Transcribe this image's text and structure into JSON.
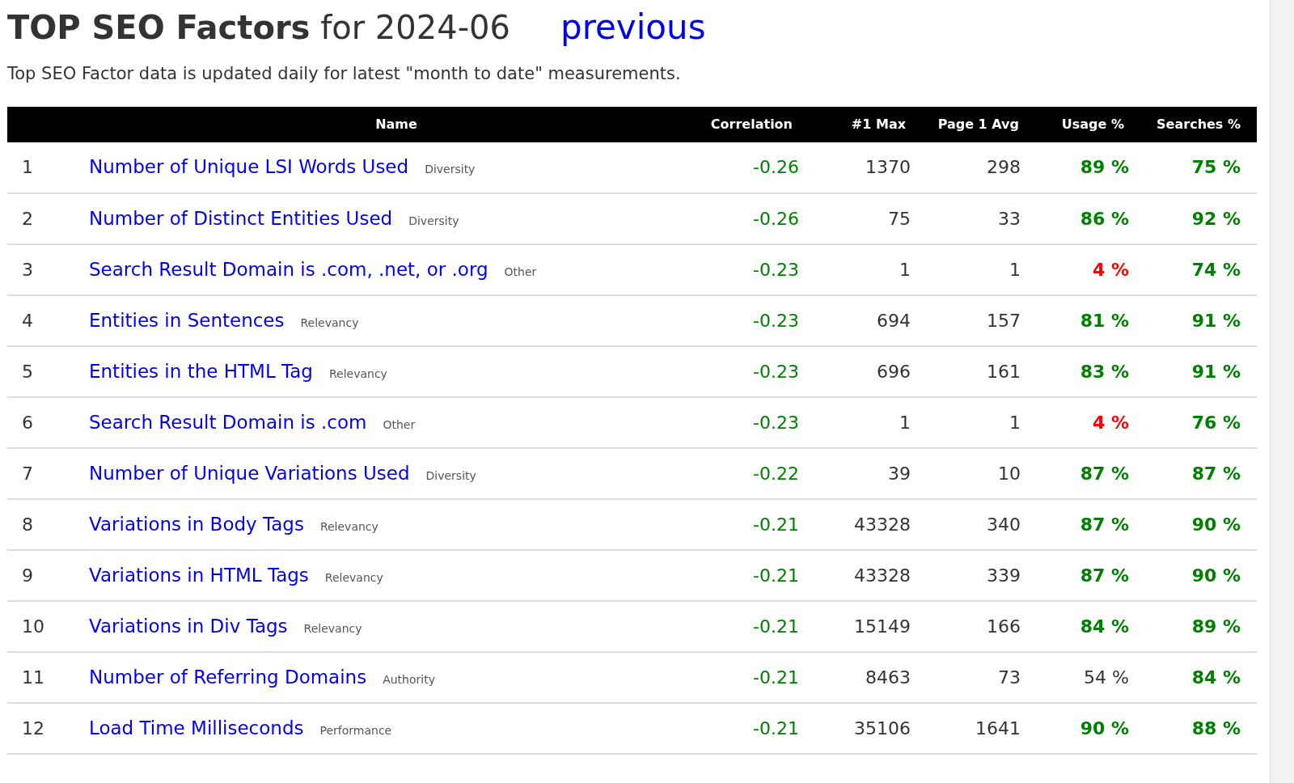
{
  "heading": {
    "title": "**TOP SEO Factors** for 2024-06",
    "link": "previous"
  },
  "intro": "Top SEO Factor data is updated daily for latest \"month to date\" measurements.",
  "table": {
    "columns": [
      "Name",
      "Correlation",
      "#1 Max",
      "Page 1 Avg",
      "Usage %",
      "Searches %"
    ],
    "rows": [
      {
        "rank": "1",
        "name": "Number of Unique LSI Words Used",
        "category": "Diversity",
        "correlation": "-0.26",
        "max": "1370",
        "avg": "298",
        "usage": {
          "text": "89 %",
          "kind": "good"
        },
        "searches": {
          "text": "75 %",
          "kind": "good"
        }
      },
      {
        "rank": "2",
        "name": "Number of Distinct Entities Used",
        "category": "Diversity",
        "correlation": "-0.26",
        "max": "75",
        "avg": "33",
        "usage": {
          "text": "86 %",
          "kind": "good"
        },
        "searches": {
          "text": "92 %",
          "kind": "good"
        }
      },
      {
        "rank": "3",
        "name": "Search Result Domain is .com, .net, or .org",
        "category": "Other",
        "correlation": "-0.23",
        "max": "1",
        "avg": "1",
        "usage": {
          "text": "4 %",
          "kind": "bad"
        },
        "searches": {
          "text": "74 %",
          "kind": "good"
        }
      },
      {
        "rank": "4",
        "name": "Entities in Sentences",
        "category": "Relevancy",
        "correlation": "-0.23",
        "max": "694",
        "avg": "157",
        "usage": {
          "text": "81 %",
          "kind": "good"
        },
        "searches": {
          "text": "91 %",
          "kind": "good"
        }
      },
      {
        "rank": "5",
        "name": "Entities in the HTML Tag",
        "category": "Relevancy",
        "correlation": "-0.23",
        "max": "696",
        "avg": "161",
        "usage": {
          "text": "83 %",
          "kind": "good"
        },
        "searches": {
          "text": "91 %",
          "kind": "good"
        }
      },
      {
        "rank": "6",
        "name": "Search Result Domain is .com",
        "category": "Other",
        "correlation": "-0.23",
        "max": "1",
        "avg": "1",
        "usage": {
          "text": "4 %",
          "kind": "bad"
        },
        "searches": {
          "text": "76 %",
          "kind": "good"
        }
      },
      {
        "rank": "7",
        "name": "Number of Unique Variations Used",
        "category": "Diversity",
        "correlation": "-0.22",
        "max": "39",
        "avg": "10",
        "usage": {
          "text": "87 %",
          "kind": "good"
        },
        "searches": {
          "text": "87 %",
          "kind": "good"
        }
      },
      {
        "rank": "8",
        "name": "Variations in Body Tags",
        "category": "Relevancy",
        "correlation": "-0.21",
        "max": "43328",
        "avg": "340",
        "usage": {
          "text": "87 %",
          "kind": "good"
        },
        "searches": {
          "text": "90 %",
          "kind": "good"
        }
      },
      {
        "rank": "9",
        "name": "Variations in HTML Tags",
        "category": "Relevancy",
        "correlation": "-0.21",
        "max": "43328",
        "avg": "339",
        "usage": {
          "text": "87 %",
          "kind": "good"
        },
        "searches": {
          "text": "90 %",
          "kind": "good"
        }
      },
      {
        "rank": "10",
        "name": "Variations in Div Tags",
        "category": "Relevancy",
        "correlation": "-0.21",
        "max": "15149",
        "avg": "166",
        "usage": {
          "text": "84 %",
          "kind": "good"
        },
        "searches": {
          "text": "89 %",
          "kind": "good"
        }
      },
      {
        "rank": "11",
        "name": "Number of Referring Domains",
        "category": "Authority",
        "correlation": "-0.21",
        "max": "8463",
        "avg": "73",
        "usage": {
          "text": "54 %",
          "kind": "neutral"
        },
        "searches": {
          "text": "84 %",
          "kind": "good"
        }
      },
      {
        "rank": "12",
        "name": "Load Time Milliseconds",
        "category": "Performance",
        "correlation": "-0.21",
        "max": "35106",
        "avg": "1641",
        "usage": {
          "text": "90 %",
          "kind": "good"
        },
        "searches": {
          "text": "88 %",
          "kind": "good"
        }
      }
    ]
  }
}
